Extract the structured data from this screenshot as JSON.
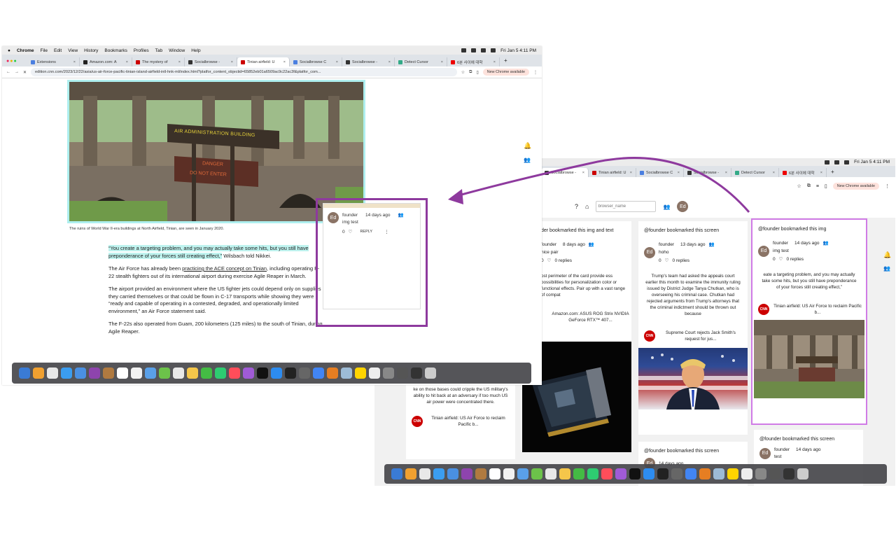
{
  "left": {
    "menubar": {
      "app": "Chrome",
      "items": [
        "File",
        "Edit",
        "View",
        "History",
        "Bookmarks",
        "Profiles",
        "Tab",
        "Window",
        "Help"
      ],
      "clock": "Fri Jan 5  4:11 PM"
    },
    "tabs": [
      {
        "label": "Extensions",
        "color": "#4a7fe0"
      },
      {
        "label": "Amazon.com: A",
        "color": "#222"
      },
      {
        "label": "The mystery of",
        "color": "#c00"
      },
      {
        "label": "Socialbrowse -",
        "color": "#333"
      },
      {
        "label": "Tinian airfield: U",
        "color": "#c00",
        "active": true
      },
      {
        "label": "Socialbrowse C",
        "color": "#4a7fe0"
      },
      {
        "label": "Socialbrowse -",
        "color": "#333"
      },
      {
        "label": "Detect Cursor",
        "color": "#3a8"
      },
      {
        "label": "6분 사이에 대학",
        "color": "#e00"
      }
    ],
    "url": "edition.cnn.com/2023/12/22/asia/us-air-force-pacific-tinian-island-airfield-intl-hnk-ml/index.html?platfor_content_objectid=65852eb01a6509ac9c22ac3f&platfor_com...",
    "new_chrome": "New Chrome available",
    "sign_text_1": "AIR ADMINISTRATION BUILDING",
    "sign_text_2": "DANGER",
    "sign_text_3": "DO NOT ENTER",
    "caption": "The ruins of World War II-era buildings at North Airfield, Tinian, are seen in January 2020.",
    "para1_quote": "“You create a targeting problem, and you may actually take some hits, but you still have preponderance of your forces still creating effect,”",
    "para1_tail": " Wilsbach told Nikkei.",
    "para2_a": "The Air Force has already been ",
    "para2_link": "practicing the ACE concept on Tinian",
    "para2_b": ", including operating F-22 stealth fighters out of its international airport during exercise Agile Reaper in March.",
    "para3": "The airport provided an environment where the US fighter jets could depend only on supplies they carried themselves or that could be flown in C-17 transports while showing they were “ready and capable of operating in a contested, degraded, and operationally limited environment,” an Air Force statement said.",
    "para4": "The F-22s also operated from Guam, 200 kilometers (125 miles) to the south of Tinian, during Agile Reaper.",
    "popup": {
      "avatar": "Ed",
      "user": "founder",
      "time": "14 days ago",
      "text": "img test",
      "count": "0",
      "reply": "REPLY"
    }
  },
  "right": {
    "menubar": {
      "item": "ndow",
      "clock": "Fri Jan 5  4:11 PM"
    },
    "tabs": [
      {
        "label": "Socialbrowse -",
        "color": "#333",
        "active": true
      },
      {
        "label": "Tinian airfield: U",
        "color": "#c00"
      },
      {
        "label": "Socialbrowse C",
        "color": "#4a7fe0"
      },
      {
        "label": "Socialbrowse -",
        "color": "#333"
      },
      {
        "label": "Detect Cursor",
        "color": "#3a8"
      },
      {
        "label": "6분 사이에 대학",
        "color": "#e00"
      }
    ],
    "new_chrome": "New Chrome available",
    "toolbar": {
      "help": "?",
      "search_placeholder": "browser_name",
      "avatar": "Ed"
    },
    "col1": {
      "header": "der bookmarked this img and text",
      "user": "founder",
      "time": "8 days ago",
      "text": "nice pair",
      "likes": "0",
      "replies": "0 replies",
      "snippet": "ost perimeter of the card provide ess possibilities for personalization color or functional effects. Pair up with a vast range of compat",
      "source": "Amazon.com: ASUS ROG Strix NVIDIA GeForce RTX™ 407..."
    },
    "col2": {
      "header": "@founder bookmarked this screen",
      "user": "founder",
      "time": "13 days ago",
      "text": "hoho",
      "likes": "0",
      "replies": "0 replies",
      "snippet": "Trump's team had asked the appeals court earlier this month to examine the immunity ruling issued by District Judge Tanya Chutkan, who is overseeing his criminal case. Chutkan had rejected arguments from Trump's attorneys that the criminal indictment should be thrown out because",
      "source": "Supreme Court rejects Jack Smith's request for jus...",
      "header2": "@founder bookmarked this screen",
      "time2": "14 days ago"
    },
    "col3": {
      "header": "@founder bookmarked this img",
      "user": "founder",
      "time": "14 days ago",
      "text": "img test",
      "likes": "0",
      "replies": "0 replies",
      "snippet": "eate a targeting problem, and you may actually take some hits, but you still have preponderance of your forces still creating effect,”",
      "source": "Tinian airfield: US Air Force to reclaim Pacific b...",
      "header2": "@founder bookmarked this screen",
      "user2": "founder",
      "time2": "14 days ago",
      "text2": "test"
    },
    "col0": {
      "snippet": "ke on those bases could cripple the US military's ability to hit back at an adversary if too much US air power were concentrated there.",
      "source": "Tinian airfield: US Air Force to reclaim Pacific b..."
    },
    "cnn": "CNN"
  },
  "colors": {
    "accent_purple": "#8e3a9e",
    "highlight": "#bff3ef",
    "cnn_red": "#cc0000"
  }
}
